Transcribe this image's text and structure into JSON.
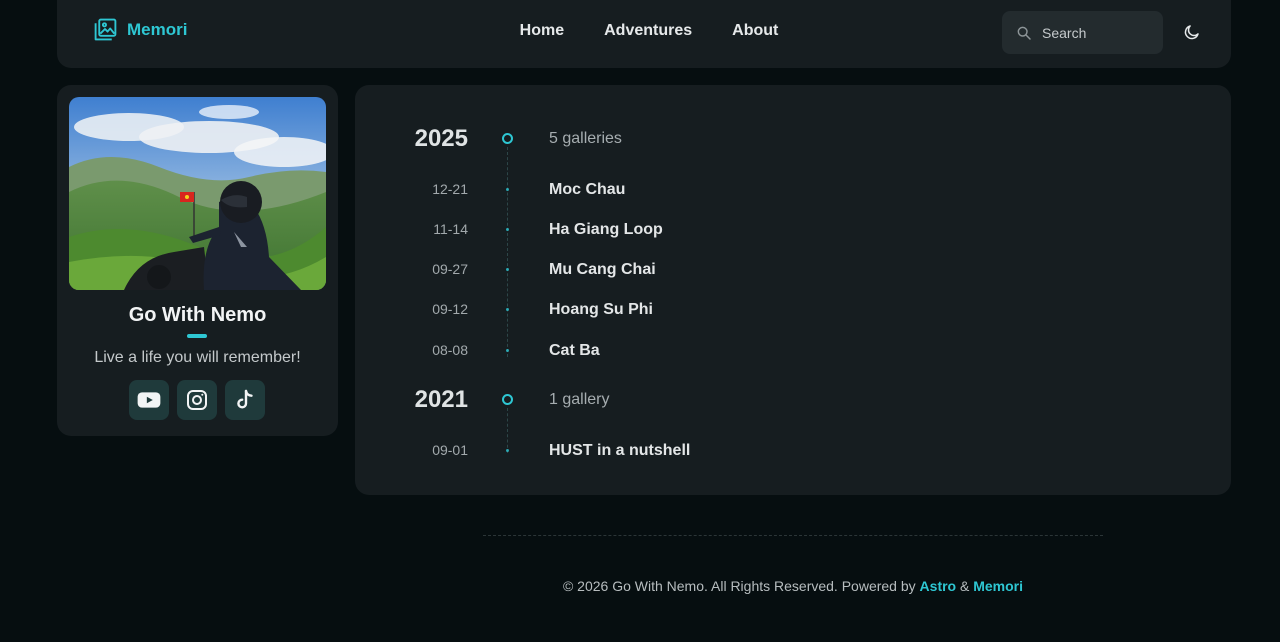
{
  "header": {
    "logo_text": "Memori",
    "nav": [
      {
        "label": "Home"
      },
      {
        "label": "Adventures"
      },
      {
        "label": "About"
      }
    ],
    "search_placeholder": "Search"
  },
  "profile": {
    "name": "Go With Nemo",
    "tagline": "Live a life you will remember!",
    "socials": [
      "youtube-icon",
      "instagram-icon",
      "tiktok-icon"
    ]
  },
  "timeline": [
    {
      "year": "2025",
      "count": "5 galleries",
      "items": [
        {
          "date": "12-21",
          "title": "Moc Chau"
        },
        {
          "date": "11-14",
          "title": "Ha Giang Loop"
        },
        {
          "date": "09-27",
          "title": "Mu Cang Chai"
        },
        {
          "date": "09-12",
          "title": "Hoang Su Phi"
        },
        {
          "date": "08-08",
          "title": "Cat Ba"
        }
      ]
    },
    {
      "year": "2021",
      "count": "1 gallery",
      "items": [
        {
          "date": "09-01",
          "title": "HUST in a nutshell"
        }
      ]
    }
  ],
  "footer": {
    "text": "© 2026 Go With Nemo. All Rights Reserved. Powered by",
    "link1": "Astro",
    "amp": "&",
    "link2": "Memori"
  },
  "colors": {
    "accent": "#2ec7d3",
    "background": "#060e10",
    "card": "#161d20"
  }
}
